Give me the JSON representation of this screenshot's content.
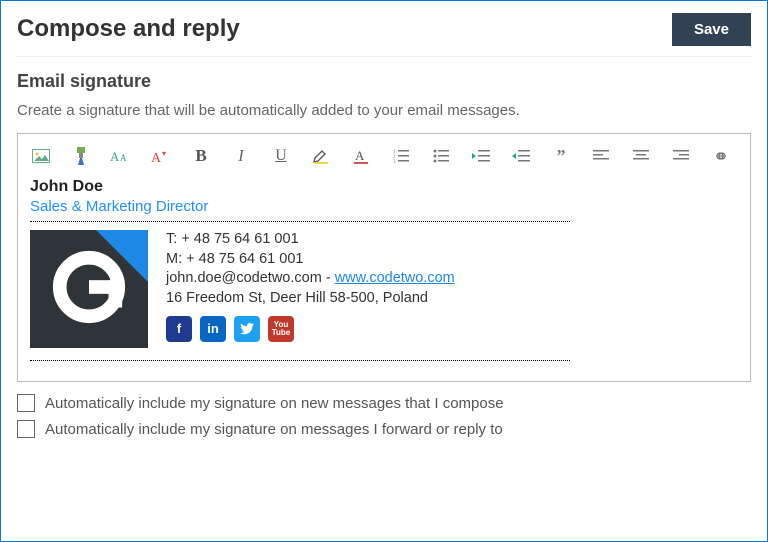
{
  "header": {
    "title": "Compose and reply",
    "save_label": "Save"
  },
  "section": {
    "title": "Email signature",
    "description": "Create a signature that will be automatically added to your email messages."
  },
  "toolbar_icons": [
    "insert-image-icon",
    "format-painter-icon",
    "font-size-icon",
    "font-size-superscript-icon",
    "bold-icon",
    "italic-icon",
    "underline-icon",
    "highlight-icon",
    "font-color-icon",
    "numbered-list-icon",
    "bulleted-list-icon",
    "outdent-icon",
    "indent-icon",
    "quote-icon",
    "align-left-icon",
    "align-center-icon",
    "align-right-icon",
    "insert-link-icon"
  ],
  "signature": {
    "name": "John Doe",
    "role": "Sales & Marketing Director",
    "tel_label": "T: ",
    "tel": "+ 48 75 64 61 001",
    "mobile_label": "M: ",
    "mobile": "+ 48 75 64 61 001",
    "email": "john.doe@codetwo.com",
    "separator": " - ",
    "website": "www.codetwo.com",
    "address": "16 Freedom St, Deer Hill 58-500, Poland",
    "logo_letter": "G",
    "socials": {
      "facebook": "f",
      "linkedin": "in",
      "twitter": "t",
      "youtube": "You\nTube"
    }
  },
  "options": {
    "include_new": "Automatically include my signature on new messages that I compose",
    "include_reply": "Automatically include my signature on messages I forward or reply to"
  }
}
